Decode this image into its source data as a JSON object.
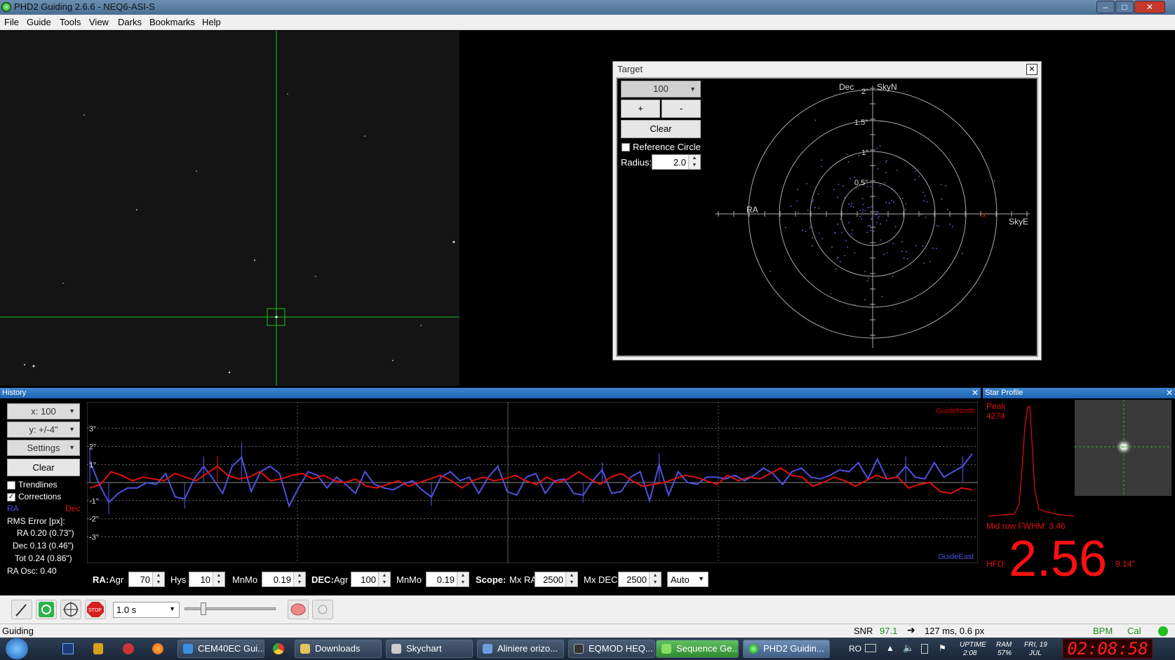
{
  "window": {
    "title": "PHD2 Guiding 2.6.6 - NEQ6-ASI-S"
  },
  "menu": [
    "File",
    "Guide",
    "Tools",
    "View",
    "Darks",
    "Bookmarks",
    "Help"
  ],
  "target": {
    "title": "Target",
    "zoom": "100",
    "plus": "+",
    "minus": "-",
    "clear": "Clear",
    "reference_circle": "Reference Circle",
    "radius_label": "Radius:",
    "radius_value": "2.0",
    "axis_top": "Dec",
    "axis_skyn": "SkyN",
    "axis_ra": "RA",
    "axis_skye": "SkyE",
    "ring_labels": [
      "2\"",
      "1.5\"",
      "1\"",
      "0.5\""
    ]
  },
  "history": {
    "title": "History",
    "x_scale": "x: 100",
    "y_scale": "y: +/-4\"",
    "settings": "Settings",
    "clear": "Clear",
    "trendlines": "Trendlines",
    "corrections": "Corrections",
    "ra_label": "RA",
    "dec_label": "Dec",
    "rms_title": "RMS Error [px]:",
    "rms_ra": "RA 0.20 (0.73\")",
    "rms_dec": "Dec 0.13 (0.46\")",
    "rms_tot": "Tot 0.24 (0.86\")",
    "ra_osc": "RA Osc: 0.40",
    "guide_north": "GuideNorth",
    "guide_east": "GuideEast",
    "y_labels": [
      "3\"",
      "2\"",
      "1\"",
      "-1\"",
      "-2\"",
      "-3\""
    ],
    "ra_color": "#5050e0",
    "dec_color": "#e01010",
    "chart_data": {
      "type": "line",
      "ylim": [
        -4,
        4
      ],
      "series": [
        {
          "name": "RA",
          "values": [
            1.2,
            -0.1,
            -1.1,
            -0.6,
            -0.3,
            -0.3,
            0.0,
            -0.1,
            0.5,
            -0.8,
            -0.9,
            0.2,
            0.9,
            0.2,
            -0.6,
            0.9,
            1.4,
            -0.5,
            0.6,
            0.9,
            0.5,
            -1.3,
            -0.3,
            0.6,
            0.4,
            -0.3,
            0.3,
            -0.1,
            -0.6,
            0.6,
            -0.1,
            -0.3,
            -0.4,
            -0.1,
            0.1,
            -0.4,
            -0.8,
            0.3,
            0.6,
            0.1,
            0.3,
            -0.6,
            0.3,
            0.9,
            -0.5,
            -0.7,
            0.3,
            0.5,
            -0.6,
            0.1,
            0.2,
            -0.6,
            -0.7,
            0.1,
            0.7,
            -0.6,
            -0.5,
            0.3,
            0.6,
            -1.0,
            1.0,
            -0.7,
            0.6,
            0.0,
            -0.1,
            0.3,
            0.3,
            0.2,
            0.4,
            0.1,
            0.4,
            0.8,
            0.5,
            -0.1,
            0.6,
            0.8,
            0.3,
            0.2,
            0.4,
            0.7,
            0.6,
            1.1,
            0.2,
            1.3,
            0.2,
            0.3,
            0.9,
            0.3,
            0.2,
            1.1,
            0.3,
            0.6,
            0.9,
            1.6
          ]
        },
        {
          "name": "Dec",
          "values": [
            -0.3,
            -0.1,
            0.6,
            0.4,
            0.1,
            0.3,
            0.2,
            0.1,
            0.5,
            0.3,
            0.1,
            0.5,
            0.9,
            0.4,
            0.2,
            0.3,
            0.6,
            0.1,
            0.2,
            0.4,
            0.5,
            0.2,
            0.4,
            0.1,
            0.0,
            0.2,
            -0.2,
            -0.3,
            -0.1,
            0.1,
            -0.2,
            0.0,
            0.2,
            0.4,
            0.1,
            -0.3,
            0.1,
            0.3,
            0.1,
            0.2,
            0.4,
            0.1,
            -0.1,
            0.3,
            0.0,
            0.2,
            0.6,
            0.2,
            -0.1,
            0.3,
            0.5,
            0.1,
            -0.2,
            -0.1,
            0.0,
            0.2,
            0.4,
            0.3,
            0.1,
            -0.1,
            0.4,
            0.1,
            0.3,
            0.2,
            0.5,
            0.8,
            0.4,
            0.3,
            -0.2,
            0.0,
            0.3,
            0.1,
            -0.2,
            0.1,
            0.4,
            0.2,
            0.3,
            -0.3,
            -0.1,
            0.0,
            -0.5,
            -0.6,
            -0.3,
            -0.4
          ]
        }
      ]
    }
  },
  "params": {
    "ra_label": "RA:",
    "agr_label": "Agr",
    "ra_agr": "70",
    "hys_label": "Hys",
    "hys": "10",
    "mnmo_label": "MnMo",
    "ra_mnmo": "0.19",
    "dec_label": "DEC:",
    "dec_agr": "100",
    "dec_mnmo": "0.19",
    "scope_label": "Scope:",
    "mxra_label": "Mx RA",
    "mx_ra": "2500",
    "mxdec_label": "Mx DEC",
    "mx_dec": "2500",
    "mode": "Auto"
  },
  "star_profile": {
    "title": "Star Profile",
    "peak_label": "Peak",
    "peak_value": "4274",
    "fwhm": "Mid row FWHM: 3.46",
    "hfd_label": "HFD:",
    "hfd_value": "2.56",
    "hfd_arcsec": "9.14\""
  },
  "toolbar": {
    "exposure": "1.0 s"
  },
  "status": {
    "state": "Guiding",
    "snr_label": "SNR",
    "snr_value": "97.1",
    "guide_info": "127 ms, 0.6 px",
    "bpm": "BPM",
    "cal": "Cal"
  },
  "taskbar": {
    "items": [
      "CEM40EC Gui...",
      "Downloads",
      "Skychart",
      "Aliniere orizo...",
      "EQMOD HEQ...",
      "Sequence Ge...",
      "PHD2 Guidin..."
    ],
    "lang": "RO",
    "uptime_label": "UPTIME",
    "uptime": "2:08",
    "ram_label": "RAM",
    "ram": "57%",
    "day": "FRI, 19",
    "month": "JUL",
    "clock": "02:08:58"
  }
}
